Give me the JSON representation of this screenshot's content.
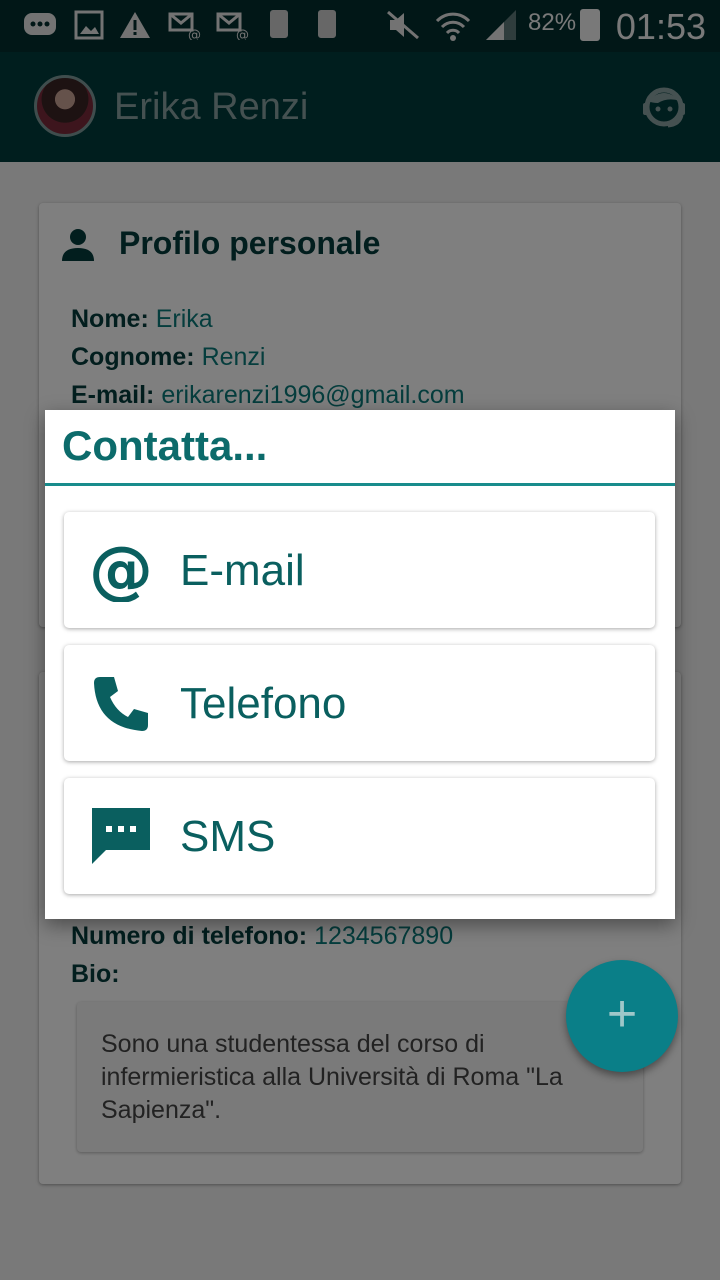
{
  "status_bar": {
    "battery_percent": "82%",
    "time": "01:53"
  },
  "app_bar": {
    "title": "Erika Renzi"
  },
  "profile": {
    "title": "Profilo personale",
    "name_label": "Nome:",
    "name_value": "Erika",
    "surname_label": "Cognome:",
    "surname_value": "Renzi",
    "email_label": "E-mail:",
    "email_value": "erikarenzi1996@gmail.com",
    "phone_label": "Numero di telefono:",
    "phone_value": "1234567890",
    "bio_label": "Bio:",
    "bio_text": "Sono una studentessa del corso di infermieristica alla Università di Roma \"La Sapienza\"."
  },
  "fab": {
    "label": "+"
  },
  "dialog": {
    "title": "Contatta...",
    "options": [
      {
        "label": "E-mail",
        "icon": "at-sign-icon"
      },
      {
        "label": "Telefono",
        "icon": "phone-icon"
      },
      {
        "label": "SMS",
        "icon": "sms-icon"
      }
    ]
  },
  "colors": {
    "primary_dark": "#003c3c",
    "accent": "#0aa5b0",
    "dialog_text": "#0a5f5f"
  }
}
